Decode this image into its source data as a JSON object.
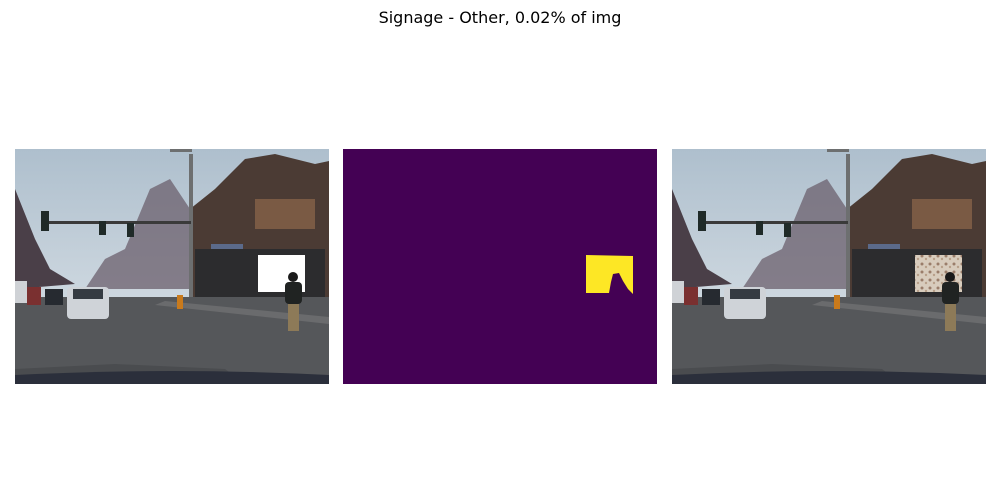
{
  "figure": {
    "title": "Signage - Other, 0.02% of img"
  },
  "panels": [
    {
      "name": "masked-street-image"
    },
    {
      "name": "segmentation-mask"
    },
    {
      "name": "original-street-image"
    }
  ],
  "colors": {
    "mask_background": "#440154",
    "mask_foreground": "#fde725",
    "masked_fill": "#ffffff"
  }
}
